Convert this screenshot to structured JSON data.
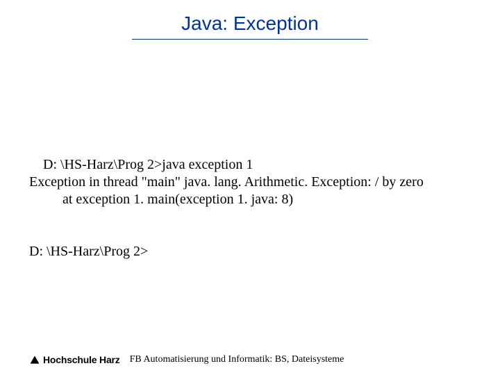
{
  "title": "Java: Exception",
  "console": {
    "line1": "D: \\HS-Harz\\Prog 2>java exception 1",
    "line2": "Exception in thread \"main\" java. lang. Arithmetic. Exception: / by zero",
    "line3": "at exception 1. main(exception 1. java: 8)",
    "line4": "D: \\HS-Harz\\Prog 2>"
  },
  "footer": {
    "logo_name": "Hochschule Harz",
    "text": "FB Automatisierung und Informatik: BS, Dateisysteme"
  }
}
